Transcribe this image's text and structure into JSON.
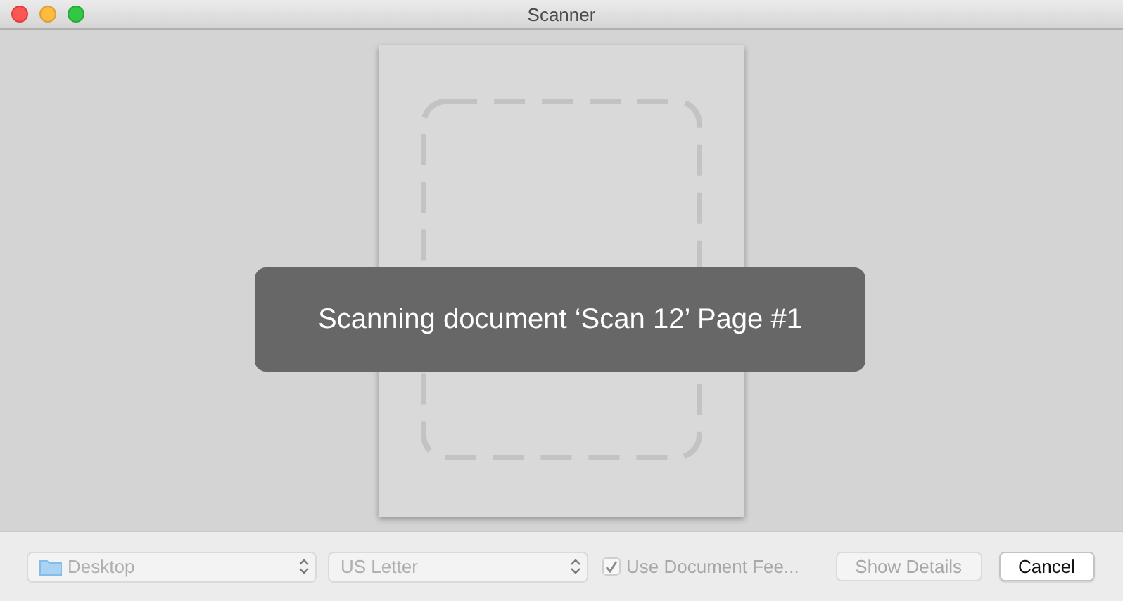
{
  "window": {
    "title": "Scanner"
  },
  "preview": {
    "message": "Scanning document ‘Scan 12’ Page #1"
  },
  "toolbar": {
    "destination": {
      "value": "Desktop",
      "disabled": true
    },
    "paper_size": {
      "value": "US Letter",
      "disabled": true
    },
    "document_feeder": {
      "label": "Use Document Fee...",
      "checked": true,
      "disabled": true
    },
    "buttons": [
      {
        "label": "Show Details",
        "disabled": true
      },
      {
        "label": "Cancel",
        "disabled": false
      }
    ]
  }
}
